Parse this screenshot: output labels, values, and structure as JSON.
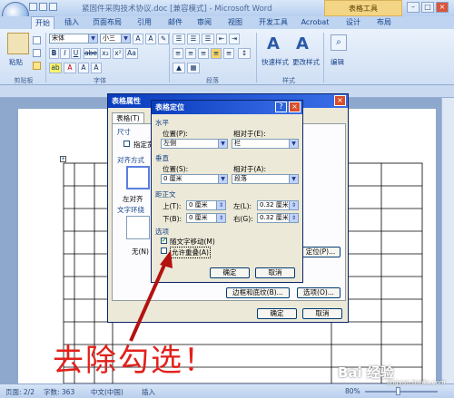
{
  "window": {
    "title": "紧固件采购技术协议.doc [兼容模式] - Microsoft Word",
    "context_tab_group": "表格工具",
    "controls": [
      "–",
      "□",
      "×"
    ]
  },
  "ribbon_tabs": [
    "开始",
    "插入",
    "页面布局",
    "引用",
    "邮件",
    "审阅",
    "视图",
    "开发工具",
    "Acrobat",
    "设计",
    "布局"
  ],
  "ribbon": {
    "paste_label": "粘贴",
    "font_name": "宋体",
    "font_size": "小三",
    "group_labels": [
      "剪贴板",
      "字体",
      "段落",
      "样式"
    ],
    "quick_styles": "快速样式",
    "change_styles": "更改样式",
    "edit": "编辑",
    "font_buttons": [
      "B",
      "I",
      "U",
      "abe",
      "x₂",
      "x²",
      "Aa",
      "A"
    ]
  },
  "table_props_dialog": {
    "title": "表格属性",
    "tab_table": "表格(T)",
    "size": "尺寸",
    "preferred_width": "指定宽",
    "alignment": "对齐方式",
    "left_align": "左对齐",
    "text_wrap": "文字环绕",
    "wrap_none": "无(N)",
    "positioning_btn": "定位(P)...",
    "borders_btn": "边框和底纹(B)...",
    "options_btn": "选项(O)...",
    "ok": "确定",
    "cancel": "取消"
  },
  "positioning_dialog": {
    "title": "表格定位",
    "horizontal": "水平",
    "position_h": "位置(P):",
    "position_h_value": "左侧",
    "relative_h": "相对于(E):",
    "relative_h_value": "栏",
    "vertical": "垂直",
    "position_v": "位置(S):",
    "position_v_value": "0 厘米",
    "relative_v": "相对于(A):",
    "relative_v_value": "段落",
    "distance": "距正文",
    "top": "上(T):",
    "top_value": "0 厘米",
    "bottom": "下(B):",
    "bottom_value": "0 厘米",
    "left": "左(L):",
    "left_value": "0.32 厘米",
    "right": "右(G):",
    "right_value": "0.32 厘米",
    "options": "选项",
    "move_with_text": "随文字移动(M)",
    "move_with_text_checked": true,
    "allow_overlap": "允许重叠(A)",
    "allow_overlap_checked": false,
    "ok": "确定",
    "cancel": "取消"
  },
  "annotation": "去除勾选！",
  "watermark": "Bai 经验",
  "watermark_url": "jingyan.baidu.com",
  "statusbar": {
    "page": "页面: 2/2",
    "words": "字数: 363",
    "language": "中文(中国)",
    "insert": "插入",
    "zoom": "80%"
  },
  "colors": {
    "annotation": "#e2201b",
    "dialog_title": "#0a3dbd",
    "ribbon": "#dbe7f8"
  }
}
